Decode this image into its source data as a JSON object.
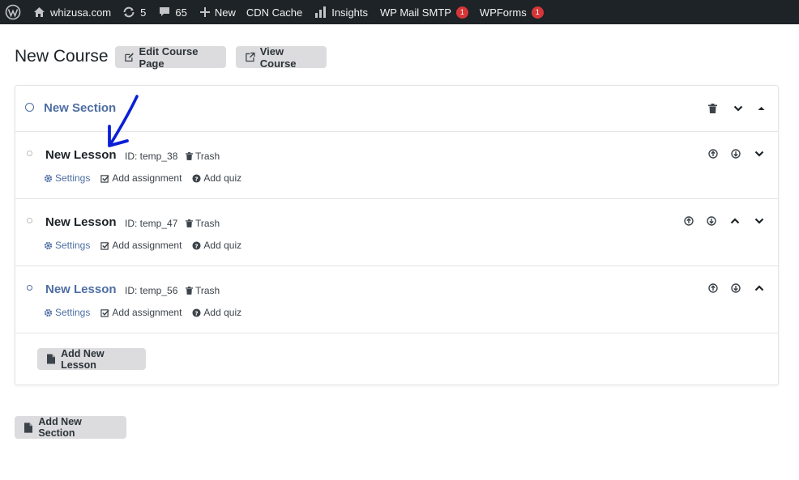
{
  "admin_bar": {
    "site_name": "whizusa.com",
    "updates_count": "5",
    "comments_count": "65",
    "new_label": "New",
    "cdn_label": "CDN Cache",
    "insights_label": "Insights",
    "smtp_label": "WP Mail SMTP",
    "smtp_badge": "1",
    "wpforms_label": "WPForms",
    "wpforms_badge": "1"
  },
  "header": {
    "title": "New Course",
    "edit_btn": "Edit Course Page",
    "view_btn": "View Course"
  },
  "section": {
    "title": "New Section"
  },
  "lessons": [
    {
      "title": "New Lesson",
      "id_text": "ID: temp_38",
      "trash": "Trash",
      "settings": "Settings",
      "assignment": "Add assignment",
      "quiz": "Add quiz"
    },
    {
      "title": "New Lesson",
      "id_text": "ID: temp_47",
      "trash": "Trash",
      "settings": "Settings",
      "assignment": "Add assignment",
      "quiz": "Add quiz"
    },
    {
      "title": "New Lesson",
      "id_text": "ID: temp_56",
      "trash": "Trash",
      "settings": "Settings",
      "assignment": "Add assignment",
      "quiz": "Add quiz"
    }
  ],
  "add_lesson_btn": "Add New Lesson",
  "add_section_btn": "Add New Section",
  "colors": {
    "admin_bar_bg": "#1d2327",
    "accent": "#4e6ea3",
    "button_bg": "#dcdcde",
    "badge": "#d63638",
    "annotation": "#0a1fd6"
  }
}
